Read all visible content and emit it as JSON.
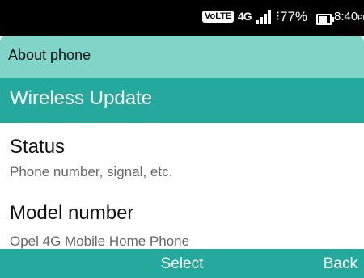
{
  "status_bar": {
    "volte": "VoLTE",
    "network": "4G",
    "battery_percent": "77%",
    "time": "8:40",
    "ampm": "PM",
    "battery_level": 0.77,
    "signal_bars": 4
  },
  "app_bar": {
    "title": "About phone"
  },
  "list": {
    "items": [
      {
        "title": "Wireless Update",
        "subtitle": "",
        "selected": true
      },
      {
        "title": "Status",
        "subtitle": "Phone number, signal, etc."
      },
      {
        "title": "Model number",
        "subtitle": "Opel 4G Mobile Home Phone"
      }
    ]
  },
  "softkeys": {
    "left": "",
    "center": "Select",
    "right": "Back"
  },
  "colors": {
    "status_bar_bg": "#000000",
    "app_bar_bg": "#80d4c8",
    "accent": "#26a99d",
    "text_primary": "#111111",
    "text_secondary": "#666666"
  }
}
